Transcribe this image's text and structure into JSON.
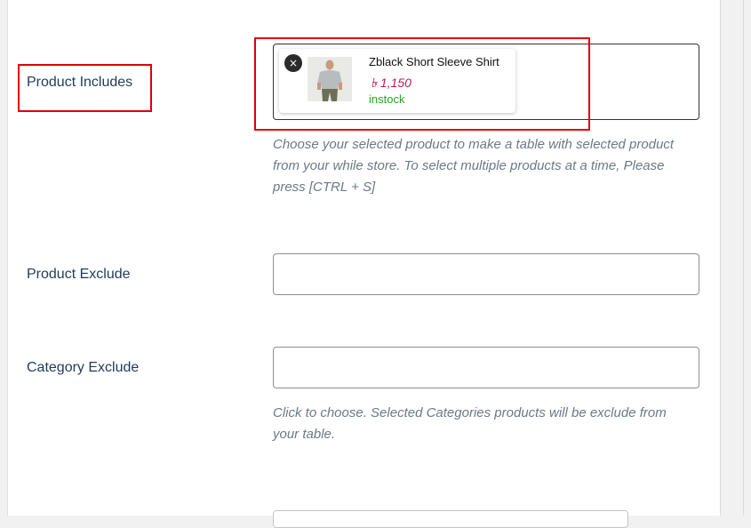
{
  "fields": {
    "product_includes": {
      "label": "Product Includes",
      "selected": {
        "name": "Zblack Short Sleeve Shirt",
        "price": "৳ 1,150",
        "stock": "instock",
        "remove_glyph": "×"
      },
      "description": "Choose your selected product to make a table with selected product from your while store. To select multiple products at a time, Please press [CTRL + S]"
    },
    "product_exclude": {
      "label": "Product Exclude"
    },
    "category_exclude": {
      "label": "Category Exclude",
      "description": "Click to choose. Selected Categories products will be exclude from your table."
    }
  },
  "colors": {
    "highlight": "#e00000",
    "label": "#1d3c5a",
    "price": "#c2185b",
    "stock": "#22a722",
    "description": "#6b7a86"
  },
  "icons": {
    "remove": "close-icon",
    "product_thumbnail": "shirt-thumbnail"
  }
}
